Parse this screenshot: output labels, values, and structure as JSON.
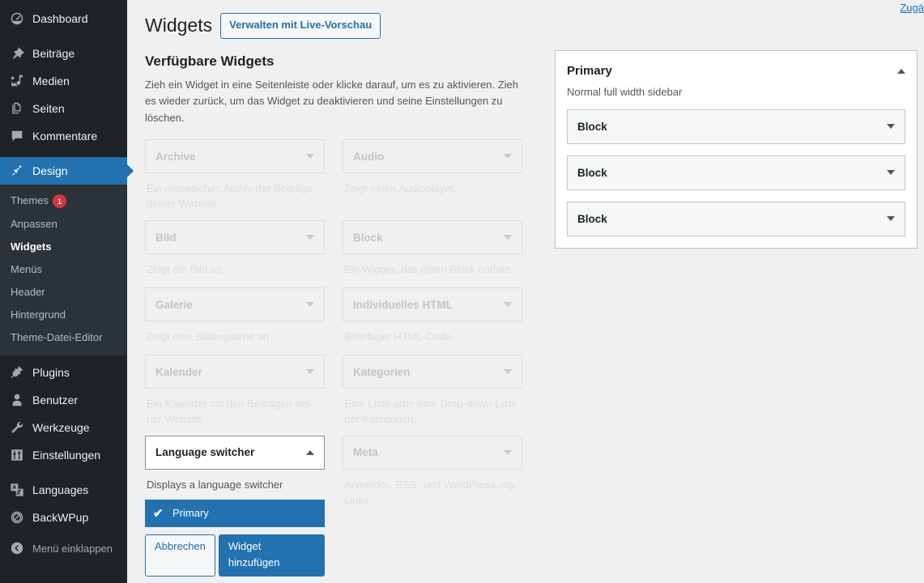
{
  "sidebar": {
    "items": [
      {
        "label": "Dashboard",
        "icon": "dashboard-icon",
        "state": "normal"
      },
      {
        "label": "Beiträge",
        "icon": "pin-icon",
        "state": "normal"
      },
      {
        "label": "Medien",
        "icon": "media-icon",
        "state": "normal"
      },
      {
        "label": "Seiten",
        "icon": "pages-icon",
        "state": "normal"
      },
      {
        "label": "Kommentare",
        "icon": "comment-icon",
        "state": "normal"
      },
      {
        "label": "Design",
        "icon": "appearance-icon",
        "state": "current"
      },
      {
        "label": "Plugins",
        "icon": "plugins-icon",
        "state": "normal"
      },
      {
        "label": "Benutzer",
        "icon": "users-icon",
        "state": "normal"
      },
      {
        "label": "Werkzeuge",
        "icon": "tools-icon",
        "state": "normal"
      },
      {
        "label": "Einstellungen",
        "icon": "settings-icon",
        "state": "normal"
      },
      {
        "label": "Languages",
        "icon": "translation-icon",
        "state": "normal"
      },
      {
        "label": "BackWPup",
        "icon": "backwpup-icon",
        "state": "normal"
      },
      {
        "label": "Menü einklappen",
        "icon": "collapse-icon",
        "state": "muted"
      }
    ],
    "submenu": {
      "parent": "Design",
      "items": [
        {
          "label": "Themes",
          "badge": "1",
          "current": false
        },
        {
          "label": "Anpassen",
          "badge": "",
          "current": false
        },
        {
          "label": "Widgets",
          "badge": "",
          "current": true
        },
        {
          "label": "Menüs",
          "badge": "",
          "current": false
        },
        {
          "label": "Header",
          "badge": "",
          "current": false
        },
        {
          "label": "Hintergrund",
          "badge": "",
          "current": false
        },
        {
          "label": "Theme-Datei-Editor",
          "badge": "",
          "current": false
        }
      ]
    }
  },
  "header": {
    "title": "Widgets",
    "live_preview_button": "Verwalten mit Live-Vorschau",
    "accessibility_link": "Zugä"
  },
  "available": {
    "heading": "Verfügbare Widgets",
    "description": "Zieh ein Widget in eine Seitenleiste oder klicke darauf, um es zu aktivieren. Zieh es wieder zurück, um das Widget zu deaktivieren und seine Einstellungen zu löschen.",
    "widgets": [
      {
        "name": "Archive",
        "desc": "Ein monatliches Archiv der Beiträge deiner Website.",
        "expanded": false
      },
      {
        "name": "Audio",
        "desc": "Zeigt einen Audioplayer.",
        "expanded": false
      },
      {
        "name": "Bild",
        "desc": "Zeigt ein Bild an.",
        "expanded": false
      },
      {
        "name": "Block",
        "desc": "Ein Widget, das einen Block enthält.",
        "expanded": false
      },
      {
        "name": "Galerie",
        "desc": "Zeigt eine Bildergalerie an.",
        "expanded": false
      },
      {
        "name": "Individuelles HTML",
        "desc": "Beliebiger HTML-Code.",
        "expanded": false
      },
      {
        "name": "Kalender",
        "desc": "Ein Kalender mit den Beiträgen dei-ner Website.",
        "expanded": false
      },
      {
        "name": "Kategorien",
        "desc": "Eine Liste oder eine Drop-down-Liste der Kategorien.",
        "expanded": false
      },
      {
        "name": "Language switcher",
        "desc": "Displays a language switcher",
        "expanded": true
      },
      {
        "name": "Meta",
        "desc": "Anmelde-, RSS- und WordPress.org-Links.",
        "expanded": false
      }
    ],
    "chooser": {
      "selected_sidebar": "Primary",
      "check_glyph": "✔",
      "cancel_label": "Abbrechen",
      "add_label": "Widget hinzufügen"
    }
  },
  "sidebar_panel": {
    "title": "Primary",
    "description": "Normal full width sidebar",
    "widgets": [
      {
        "name": "Block"
      },
      {
        "name": "Block"
      },
      {
        "name": "Block"
      }
    ]
  },
  "colors": {
    "accent": "#2271b1",
    "menu_bg": "#1d2327",
    "submenu_bg": "#2c3338",
    "badge": "#d63638",
    "page_bg": "#f0f0f1"
  }
}
